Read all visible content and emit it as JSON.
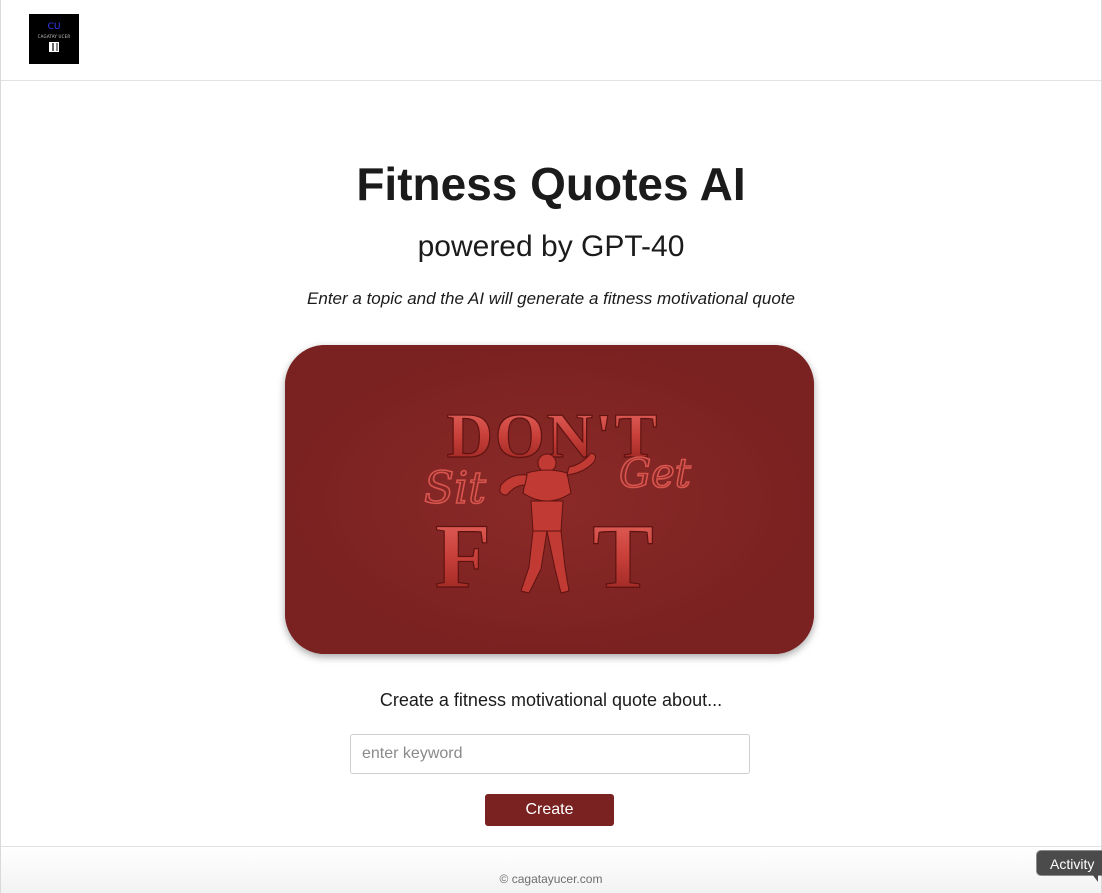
{
  "header": {
    "logo_monogram": "CU",
    "logo_brand": "CAGATAY UCER"
  },
  "main": {
    "title": "Fitness Quotes AI",
    "subtitle": "powered by GPT-40",
    "tagline": "Enter a topic and the AI will generate a fitness motivational quote",
    "hero_image": {
      "line1": "DON'T",
      "left_script": "Sit",
      "right_script": "Get",
      "line2_left": "F",
      "line2_right": "T"
    },
    "prompt": "Create a fitness motivational quote about...",
    "keyword_input": {
      "value": "",
      "placeholder": "enter keyword"
    },
    "create_label": "Create"
  },
  "footer": {
    "copyright": "© cagatayucer.com"
  },
  "activity_label": "Activity",
  "colors": {
    "brand": "#7a2221",
    "text": "#1b1b1b"
  }
}
